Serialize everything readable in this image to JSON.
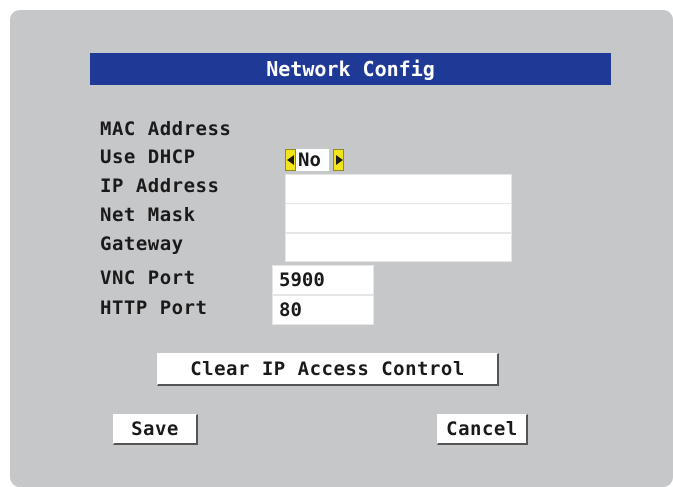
{
  "dialog": {
    "title": "Network Config"
  },
  "form": {
    "mac_address_label": "MAC Address",
    "use_dhcp_label": "Use DHCP",
    "use_dhcp_value": "No",
    "ip_address_label": "IP Address",
    "ip_address_value": "",
    "net_mask_label": "Net Mask",
    "net_mask_value": "",
    "gateway_label": "Gateway",
    "gateway_value": "",
    "vnc_port_label": "VNC Port",
    "vnc_port_value": "5900",
    "http_port_label": "HTTP Port",
    "http_port_value": "80"
  },
  "buttons": {
    "clear_ip_access": "Clear IP Access Control",
    "save": "Save",
    "cancel": "Cancel"
  },
  "colors": {
    "panel_background": "#c6c7c9",
    "title_bar": "#1f3a96",
    "selector_arrow": "#f2e41a"
  },
  "icons": {
    "dhcp_prev": "arrow-left-icon",
    "dhcp_next": "arrow-right-icon"
  }
}
